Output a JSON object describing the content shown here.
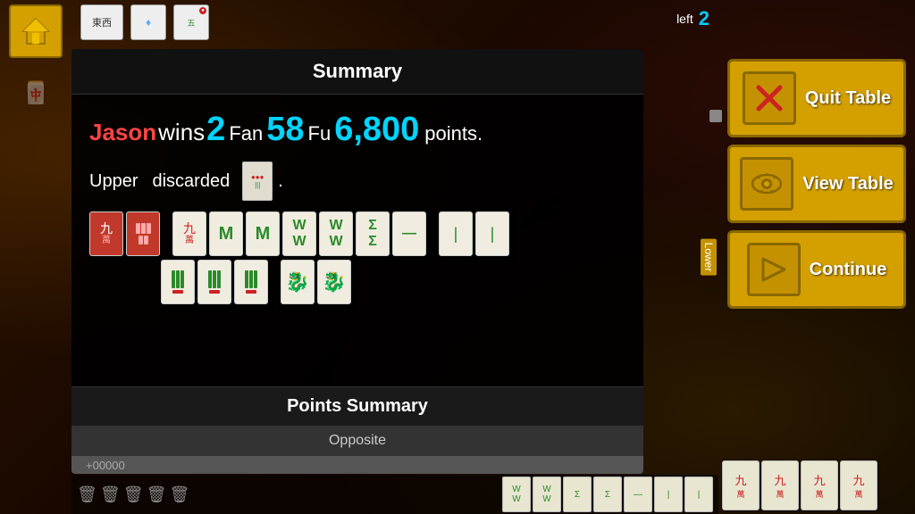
{
  "topBar": {
    "leftLabel": "left",
    "leftCount": "2",
    "tiles": [
      "東西",
      "♦",
      "五"
    ]
  },
  "summary": {
    "title": "Summary",
    "winLine": {
      "name": "Jason",
      "wins": " wins ",
      "fan": "2",
      "fanLabel": "Fan",
      "fu": "58",
      "fuLabel": "Fu",
      "points": "6,800",
      "pointsLabel": "points."
    },
    "discardLine": "Upper  discarded  .",
    "discardLineStart": "Upper",
    "discardLineMid": "discarded",
    "pointsSection": {
      "title": "Points Summary",
      "oppositeLabel": "Opposite"
    }
  },
  "buttons": {
    "quitTable": "Quit Table",
    "viewTable": "View Table",
    "continue": "Continue"
  },
  "lowerTag": "Lower",
  "bottomIcons": [
    "🗑",
    "🗑",
    "🗑",
    "🗑",
    "🗑"
  ]
}
